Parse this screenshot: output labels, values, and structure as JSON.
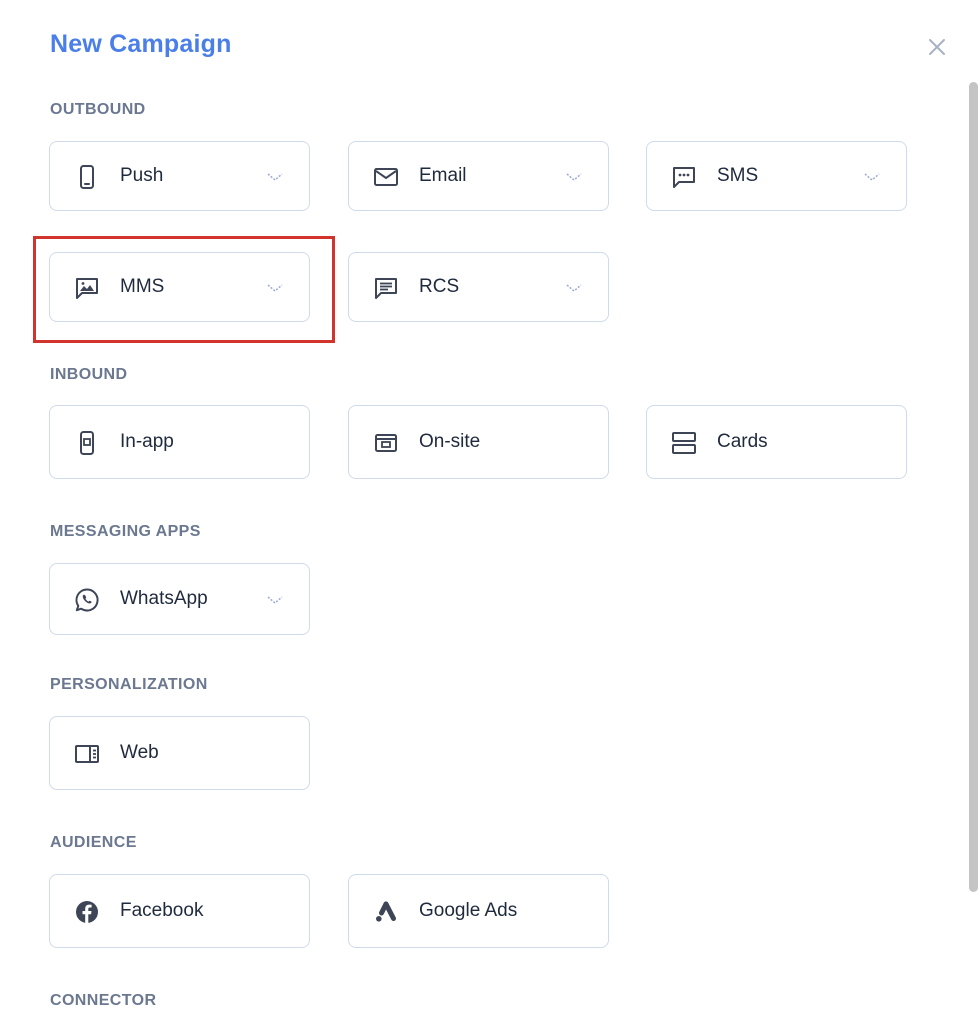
{
  "modal": {
    "title": "New Campaign"
  },
  "sections": {
    "outbound": "OUTBOUND",
    "inbound": "INBOUND",
    "messaging_apps": "MESSAGING APPS",
    "personalization": "PERSONALIZATION",
    "audience": "AUDIENCE",
    "connector": "CONNECTOR"
  },
  "channels": {
    "push": "Push",
    "email": "Email",
    "sms": "SMS",
    "mms": "MMS",
    "rcs": "RCS",
    "in_app": "In-app",
    "on_site": "On-site",
    "cards": "Cards",
    "whatsapp": "WhatsApp",
    "web": "Web",
    "facebook": "Facebook",
    "google_ads": "Google Ads"
  },
  "colors": {
    "title": "#4a7ee8",
    "section_label": "#6b7890",
    "card_border": "#cfdbea",
    "icon": "#3d4556",
    "chevron": "#9aa7d8",
    "highlight": "#d0342c"
  }
}
